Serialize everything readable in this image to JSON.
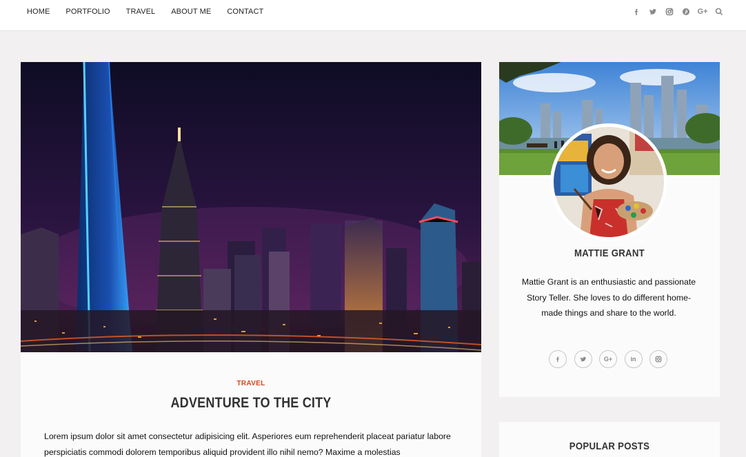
{
  "nav": {
    "items": [
      {
        "label": "HOME"
      },
      {
        "label": "PORTFOLIO"
      },
      {
        "label": "TRAVEL"
      },
      {
        "label": "ABOUT ME"
      },
      {
        "label": "CONTACT"
      }
    ],
    "social_icons": [
      "facebook-icon",
      "twitter-icon",
      "instagram-icon",
      "pinterest-icon",
      "google-plus-icon",
      "search-icon"
    ],
    "google_plus_text": "G+"
  },
  "post": {
    "category": "TRAVEL",
    "title": "ADVENTURE TO THE CITY",
    "excerpt": "Lorem ipsum dolor sit amet consectetur adipisicing elit. Asperiores eum reprehenderit placeat pariatur labore perspiciatis commodi dolorem temporibus aliquid provident illo nihil nemo? Maxime a molestias"
  },
  "about": {
    "name": "MATTIE GRANT",
    "bio": "Mattie Grant is an enthusiastic and passionate Story Teller. She loves to do different home-made things and share to the world.",
    "social_icons": [
      "facebook-icon",
      "twitter-icon",
      "google-plus-icon",
      "linkedin-icon",
      "instagram-icon"
    ],
    "google_plus_text": "G+",
    "linkedin_text": "in"
  },
  "popular": {
    "title": "POPULAR POSTS"
  },
  "colors": {
    "accent": "#d2461f",
    "background": "#f2f0f1",
    "card": "#fcfbfc"
  }
}
